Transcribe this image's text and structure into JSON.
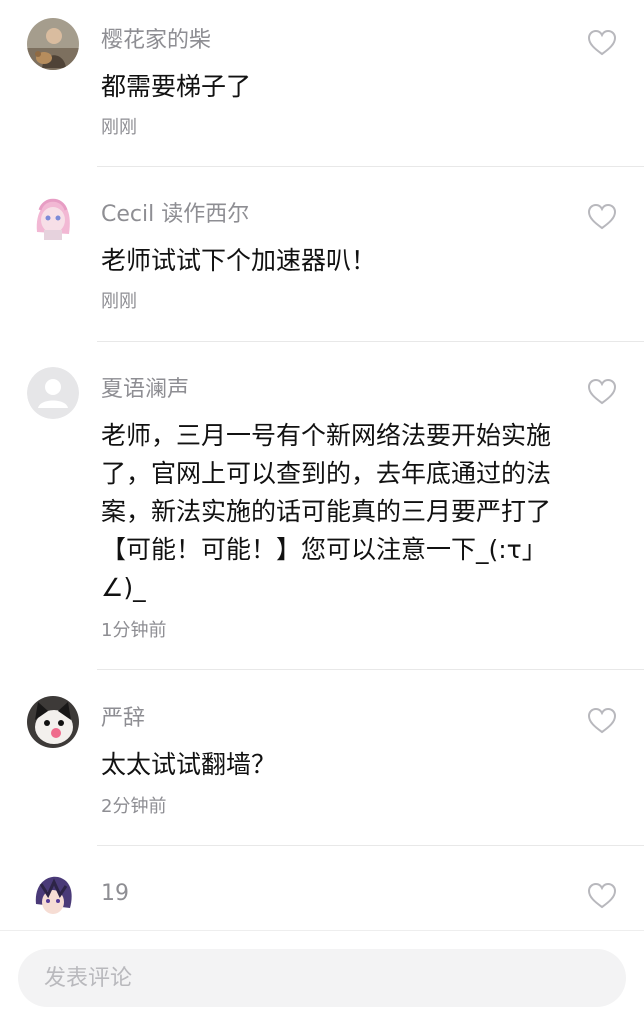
{
  "comments": [
    {
      "username": "樱花家的柴",
      "content": "都需要梯子了",
      "time": "刚刚",
      "avatar_icon": "user-photo-avatar",
      "like_icon": "heart-outline-icon"
    },
    {
      "username": "Cecil 读作西尔",
      "content": "老师试试下个加速器叭！",
      "time": "刚刚",
      "avatar_icon": "anime-girl-avatar",
      "like_icon": "heart-outline-icon"
    },
    {
      "username": "夏语澜声",
      "content": "老师，三月一号有个新网络法要开始实施了，官网上可以查到的，去年底通过的法案，新法实施的话可能真的三月要严打了【可能！可能！】您可以注意一下_(:τ」∠)_",
      "time": "1分钟前",
      "avatar_icon": "default-user-avatar",
      "like_icon": "heart-outline-icon"
    },
    {
      "username": "严辞",
      "content": "太太试试翻墙？",
      "time": "2分钟前",
      "avatar_icon": "cat-avatar",
      "like_icon": "heart-outline-icon"
    },
    {
      "username": "19",
      "content": "",
      "time": "",
      "avatar_icon": "anime-boy-avatar",
      "like_icon": "heart-outline-icon"
    }
  ],
  "comment_input": {
    "placeholder": "发表评论"
  },
  "colors": {
    "username": "#8e8e93",
    "content": "#111111",
    "time": "#8e8e93",
    "divider": "#e8e8e8",
    "input_background": "#f3f3f4",
    "placeholder": "#b9b9bd"
  }
}
